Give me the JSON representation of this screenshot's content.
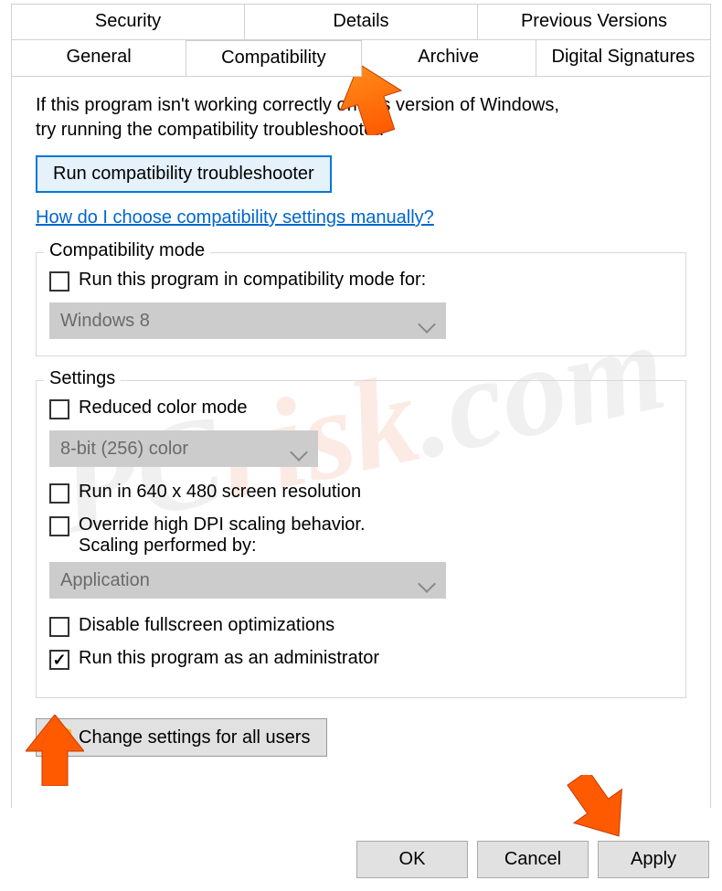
{
  "tabs": {
    "row1": [
      "Security",
      "Details",
      "Previous Versions"
    ],
    "row2": [
      "General",
      "Compatibility",
      "Archive",
      "Digital Signatures"
    ],
    "active": "Compatibility"
  },
  "intro_line1": "If this program isn't working correctly on this version of Windows,",
  "intro_line2": "try running the compatibility troubleshooter.",
  "run_troubleshooter": "Run compatibility troubleshooter",
  "help_link": "How do I choose compatibility settings manually?",
  "group_compat": {
    "legend": "Compatibility mode",
    "check_label": "Run this program in compatibility mode for:",
    "combo_value": "Windows 8"
  },
  "group_settings": {
    "legend": "Settings",
    "reduced_color": "Reduced color mode",
    "color_combo": "8-bit (256) color",
    "low_res": "Run in 640 x 480 screen resolution",
    "dpi_line1": "Override high DPI scaling behavior.",
    "dpi_line2": "Scaling performed by:",
    "dpi_combo": "Application",
    "disable_fullscreen": "Disable fullscreen optimizations",
    "run_as_admin": "Run this program as an administrator"
  },
  "change_all_users": "Change settings for all users",
  "footer": {
    "ok": "OK",
    "cancel": "Cancel",
    "apply": "Apply"
  },
  "watermark": {
    "a": "PC",
    "b": "risk",
    "c": ".com"
  }
}
